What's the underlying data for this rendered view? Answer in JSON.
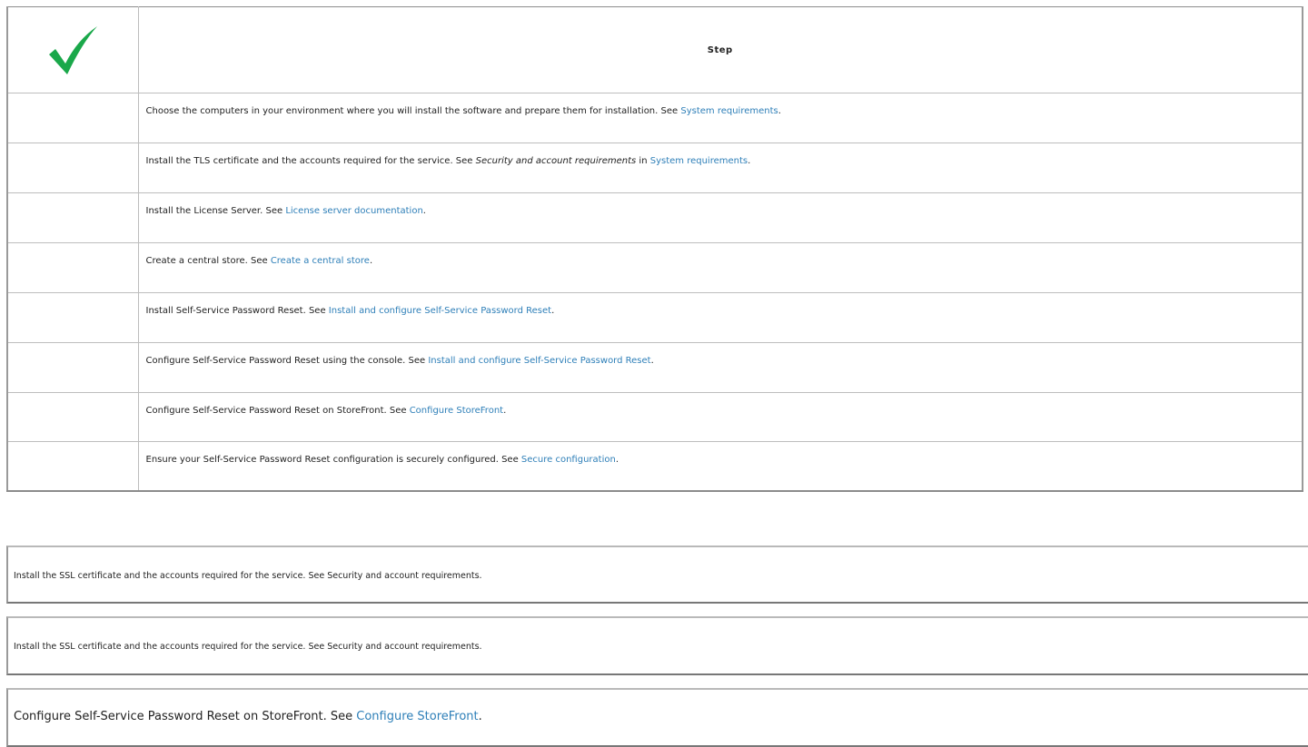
{
  "checklist": {
    "header": {
      "check_icon": "checkmark-icon",
      "step_label": "Step"
    },
    "rows": [
      {
        "text": "Choose the computers in your environment where you will install the software and prepare them for installation. See ",
        "link": "System requirements",
        "suffix": "."
      },
      {
        "text": "Install the TLS certificate and the accounts required for the service. See ",
        "em": "Security and account requirements",
        "mid": " in ",
        "link": "System requirements",
        "suffix": "."
      },
      {
        "text": "Install the License Server. See ",
        "link": "License server documentation",
        "suffix": "."
      },
      {
        "text": "Create a central store. See ",
        "link": "Create a central store",
        "suffix": "."
      },
      {
        "text": "Install Self-Service Password Reset. See ",
        "link": "Install and configure Self-Service Password Reset",
        "suffix": "."
      },
      {
        "text": "Configure Self-Service Password Reset using the console. See ",
        "link": "Install and configure Self-Service Password Reset",
        "suffix": "."
      },
      {
        "text": "Configure Self-Service Password Reset on StoreFront. See ",
        "link": "Configure StoreFront",
        "suffix": "."
      },
      {
        "text": "Ensure your Self-Service Password Reset configuration is securely configured. See ",
        "link": "Secure configuration",
        "suffix": "."
      }
    ]
  },
  "notes": [
    {
      "text": "Install the SSL certificate and the accounts required for the service. See Security and account requirements."
    },
    {
      "text": "Install the SSL certificate and the accounts required for the service. See Security and account requirements."
    },
    {
      "text": "Configure Self-Service Password Reset on StoreFront. See ",
      "link": "Configure StoreFront",
      "suffix": "."
    }
  ],
  "colors": {
    "link": "#2e7fb8",
    "checkmark": "#1aa84a",
    "border_dark": "#8c8c8c",
    "border_light": "#bdbdbd"
  }
}
